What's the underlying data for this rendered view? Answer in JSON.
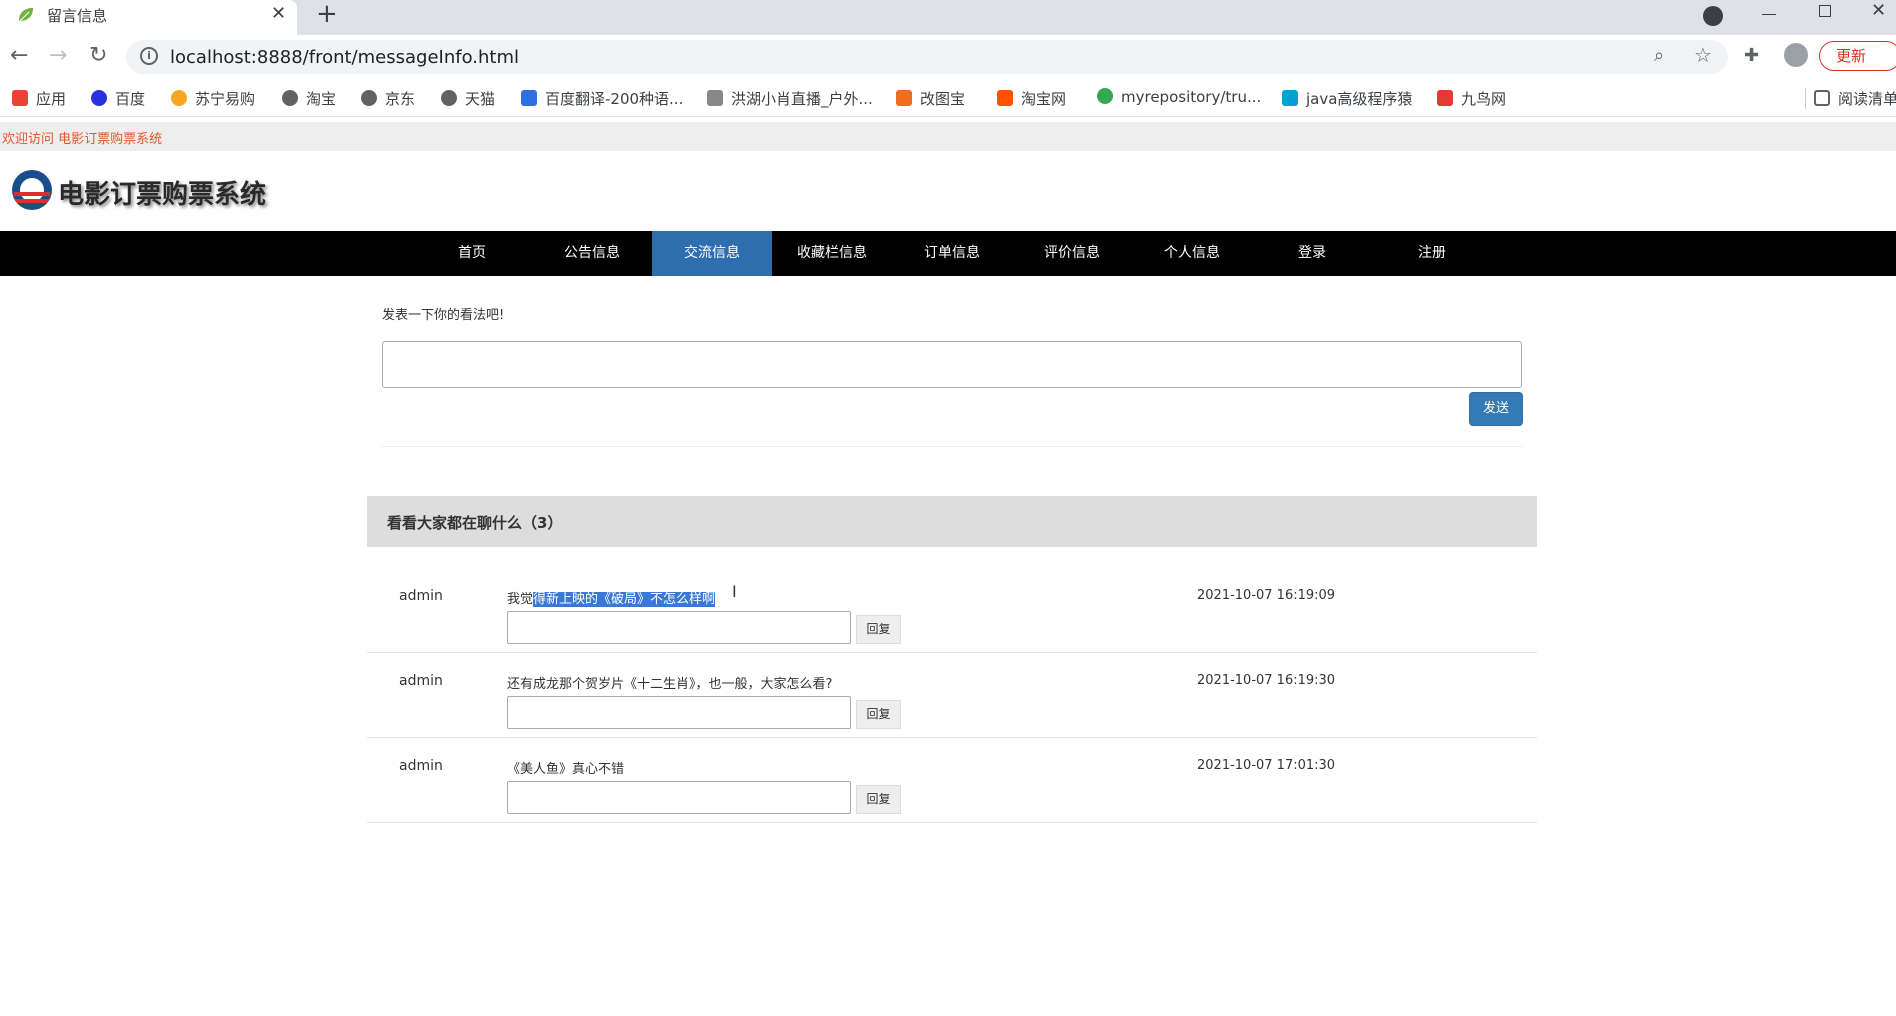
{
  "browser": {
    "tab_title": "留言信息",
    "tab_close": "✕",
    "new_tab": "+",
    "url": "localhost:8888/front/messageInfo.html",
    "update_label": "更新",
    "bookmarks": [
      {
        "label": "应用",
        "color": "#ea4335"
      },
      {
        "label": "百度",
        "color": "#2932e1"
      },
      {
        "label": "苏宁易购",
        "color": "#f5a623"
      },
      {
        "label": "淘宝",
        "color": "#5f6368"
      },
      {
        "label": "京东",
        "color": "#5f6368"
      },
      {
        "label": "天猫",
        "color": "#5f6368"
      },
      {
        "label": "百度翻译-200种语...",
        "color": "#2f6fe4"
      },
      {
        "label": "洪湖小肖直播_户外...",
        "color": "#888888"
      },
      {
        "label": "改图宝",
        "color": "#f26a1b"
      },
      {
        "label": "淘宝网",
        "color": "#ff5000"
      },
      {
        "label": "myrepository/tru...",
        "color": "#34a853"
      },
      {
        "label": "java高级程序猿",
        "color": "#00a1d6"
      },
      {
        "label": "九鸟网",
        "color": "#e53935"
      }
    ],
    "reading_list": "阅读清单"
  },
  "page": {
    "welcome": "欢迎访问 电影订票购票系统",
    "site_title": "电影订票购票系统",
    "nav": [
      "首页",
      "公告信息",
      "交流信息",
      "收藏栏信息",
      "订单信息",
      "评价信息",
      "个人信息",
      "登录",
      "注册"
    ],
    "active_nav": "交流信息",
    "post_label": "发表一下你的看法吧!",
    "send_label": "发送",
    "chat_header": "看看大家都在聊什么（3）",
    "messages": [
      {
        "user": "admin",
        "content_pre": "我觉",
        "content_hl": "得新上映的《破局》不怎么样啊",
        "content": "",
        "time": "2021-10-07 16:19:09",
        "reply_label": "回复"
      },
      {
        "user": "admin",
        "content_pre": "",
        "content_hl": "",
        "content": "还有成龙那个贺岁片《十二生肖》，也一般，大家怎么看?",
        "time": "2021-10-07 16:19:30",
        "reply_label": "回复"
      },
      {
        "user": "admin",
        "content_pre": "",
        "content_hl": "",
        "content": "《美人鱼》真心不错",
        "time": "2021-10-07 17:01:30",
        "reply_label": "回复"
      }
    ]
  }
}
